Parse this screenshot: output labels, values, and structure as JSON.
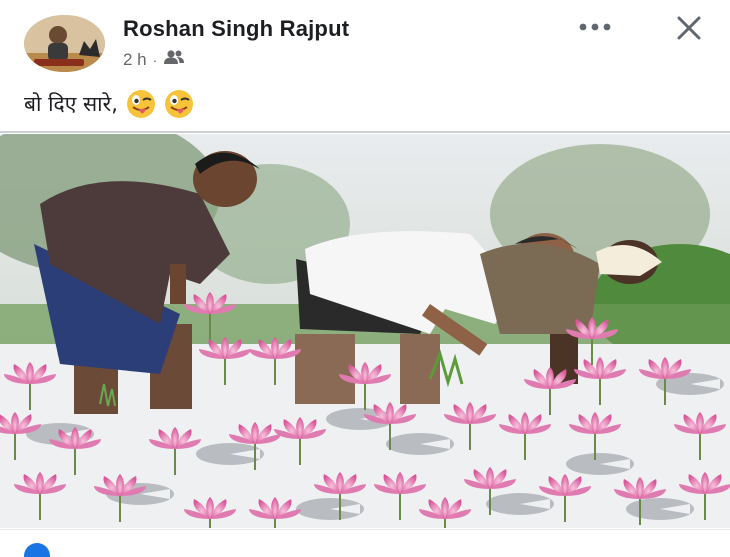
{
  "post": {
    "author": "Roshan Singh Rajput",
    "time": "2 h",
    "separator": "·",
    "audience_icon": "friends-icon",
    "caption_text": "बो दिए सारे,",
    "emojis": [
      "winking-face-with-tongue",
      "winking-face-with-tongue"
    ],
    "more_icon": "more-options-icon",
    "close_icon": "close-icon"
  },
  "colors": {
    "author_text": "#1c1e21",
    "meta_text": "#65676b",
    "divider": "#ccd0d5",
    "lotus": "#e36aa6",
    "water": "#eef0f2"
  }
}
